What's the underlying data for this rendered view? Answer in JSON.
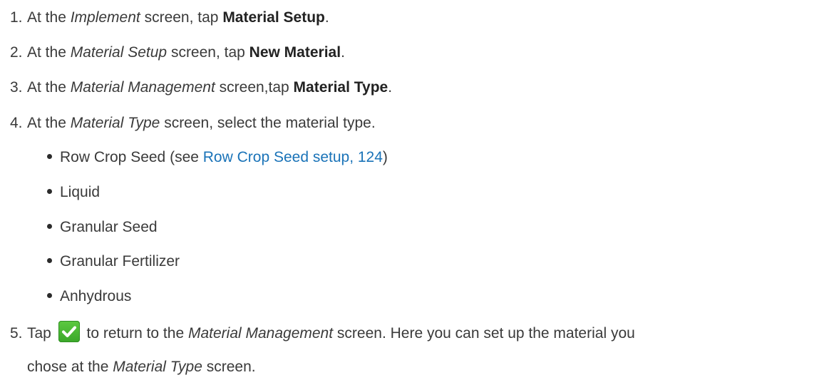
{
  "steps": [
    {
      "number": "1.",
      "prefix": "At the ",
      "italic": "Implement",
      "middle": " screen, tap ",
      "bold": "Material Setup",
      "suffix": "."
    },
    {
      "number": "2.",
      "prefix": "At the ",
      "italic": "Material Setup",
      "middle": " screen, tap ",
      "bold": "New Material",
      "suffix": "."
    },
    {
      "number": "3.",
      "prefix": "At the ",
      "italic": "Material Management",
      "middle": " screen,tap ",
      "bold": "Material Type",
      "suffix": "."
    },
    {
      "number": "4.",
      "prefix": "At the ",
      "italic": "Material Type",
      "middle": " screen, select the material type.",
      "bold": "",
      "suffix": ""
    }
  ],
  "bullets": [
    {
      "text": "Row Crop Seed (see ",
      "link": "Row Crop Seed setup, 124",
      "after": ")"
    },
    {
      "text": "Liquid",
      "link": "",
      "after": ""
    },
    {
      "text": "Granular Seed",
      "link": "",
      "after": ""
    },
    {
      "text": "Granular Fertilizer",
      "link": "",
      "after": ""
    },
    {
      "text": "Anhydrous",
      "link": "",
      "after": ""
    }
  ],
  "step5": {
    "number": "5.",
    "prefix": "Tap ",
    "after_icon": " to return to the ",
    "italic1": "Material Management",
    "middle": " screen. Here you can set up the material you",
    "line2_prefix": "chose at the ",
    "italic2": "Material Type",
    "line2_suffix": " screen.",
    "icon": "green-checkmark-icon"
  },
  "colors": {
    "text": "#3a3a3a",
    "link": "#1a73b8",
    "check_button": "#46b532"
  }
}
